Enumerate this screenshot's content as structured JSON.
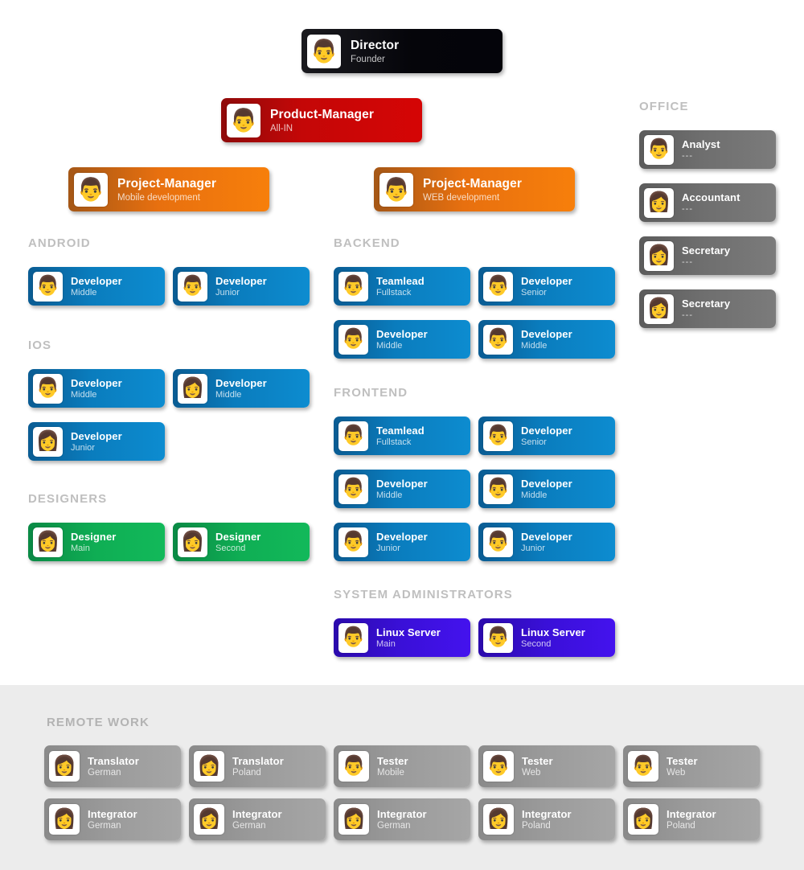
{
  "chart_data": {
    "type": "diagram",
    "title": "Company organizational chart",
    "sections": [
      "ANDROID",
      "IOS",
      "DESIGNERS",
      "BACKEND",
      "FRONTEND",
      "SYSTEM ADMINISTRATORS",
      "OFFICE",
      "REMOTE WORK"
    ]
  },
  "colors": {
    "director": "#05050a",
    "product_manager": "#cc0606",
    "project_manager": "#f07810",
    "developer": "#0b85c8",
    "designer": "#11b356",
    "sysadmin": "#3a10d8",
    "office": "#6e6e6e",
    "remote": "#9b9b9b",
    "section_heading": "#bfbfbf",
    "remote_band_bg": "#ececec",
    "page_bg": "#ffffff"
  },
  "avatars": {
    "man": "👨",
    "woman": "👩"
  },
  "top": {
    "director": {
      "title": "Director",
      "subtitle": "Founder",
      "avatar": "man"
    },
    "product_manager": {
      "title": "Product-Manager",
      "subtitle": "All-IN",
      "avatar": "man"
    },
    "project_manager_mobile": {
      "title": "Project-Manager",
      "subtitle": "Mobile development",
      "avatar": "man"
    },
    "project_manager_web": {
      "title": "Project-Manager",
      "subtitle": "WEB development",
      "avatar": "man"
    }
  },
  "sections": {
    "android": {
      "heading": "ANDROID",
      "cards": [
        {
          "title": "Developer",
          "subtitle": "Middle",
          "avatar": "man"
        },
        {
          "title": "Developer",
          "subtitle": "Junior",
          "avatar": "man"
        }
      ]
    },
    "ios": {
      "heading": "IOS",
      "cards": [
        {
          "title": "Developer",
          "subtitle": "Middle",
          "avatar": "man"
        },
        {
          "title": "Developer",
          "subtitle": "Middle",
          "avatar": "woman"
        },
        {
          "title": "Developer",
          "subtitle": "Junior",
          "avatar": "woman"
        }
      ]
    },
    "designers": {
      "heading": "DESIGNERS",
      "cards": [
        {
          "title": "Designer",
          "subtitle": "Main",
          "avatar": "woman"
        },
        {
          "title": "Designer",
          "subtitle": "Second",
          "avatar": "woman"
        }
      ]
    },
    "backend": {
      "heading": "BACKEND",
      "cards": [
        {
          "title": "Teamlead",
          "subtitle": "Fullstack",
          "avatar": "man"
        },
        {
          "title": "Developer",
          "subtitle": "Senior",
          "avatar": "man"
        },
        {
          "title": "Developer",
          "subtitle": "Middle",
          "avatar": "man"
        },
        {
          "title": "Developer",
          "subtitle": "Middle",
          "avatar": "man"
        }
      ]
    },
    "frontend": {
      "heading": "FRONTEND",
      "cards": [
        {
          "title": "Teamlead",
          "subtitle": "Fullstack",
          "avatar": "man"
        },
        {
          "title": "Developer",
          "subtitle": "Senior",
          "avatar": "man"
        },
        {
          "title": "Developer",
          "subtitle": "Middle",
          "avatar": "man"
        },
        {
          "title": "Developer",
          "subtitle": "Middle",
          "avatar": "man"
        },
        {
          "title": "Developer",
          "subtitle": "Junior",
          "avatar": "man"
        },
        {
          "title": "Developer",
          "subtitle": "Junior",
          "avatar": "man"
        }
      ]
    },
    "sysadmins": {
      "heading": "SYSTEM ADMINISTRATORS",
      "cards": [
        {
          "title": "Linux Server",
          "subtitle": "Main",
          "avatar": "man"
        },
        {
          "title": "Linux Server",
          "subtitle": "Second",
          "avatar": "man"
        }
      ]
    },
    "office": {
      "heading": "OFFICE",
      "cards": [
        {
          "title": "Analyst",
          "subtitle": "---",
          "avatar": "man"
        },
        {
          "title": "Accountant",
          "subtitle": "---",
          "avatar": "woman"
        },
        {
          "title": "Secretary",
          "subtitle": "---",
          "avatar": "woman"
        },
        {
          "title": "Secretary",
          "subtitle": "---",
          "avatar": "woman"
        }
      ]
    },
    "remote": {
      "heading": "REMOTE WORK",
      "cards": [
        {
          "title": "Translator",
          "subtitle": "German",
          "avatar": "woman"
        },
        {
          "title": "Translator",
          "subtitle": "Poland",
          "avatar": "woman"
        },
        {
          "title": "Tester",
          "subtitle": "Mobile",
          "avatar": "man"
        },
        {
          "title": "Tester",
          "subtitle": "Web",
          "avatar": "man"
        },
        {
          "title": "Tester",
          "subtitle": "Web",
          "avatar": "man"
        },
        {
          "title": "Integrator",
          "subtitle": "German",
          "avatar": "woman"
        },
        {
          "title": "Integrator",
          "subtitle": "German",
          "avatar": "woman"
        },
        {
          "title": "Integrator",
          "subtitle": "German",
          "avatar": "woman"
        },
        {
          "title": "Integrator",
          "subtitle": "Poland",
          "avatar": "woman"
        },
        {
          "title": "Integrator",
          "subtitle": "Poland",
          "avatar": "woman"
        }
      ]
    }
  }
}
